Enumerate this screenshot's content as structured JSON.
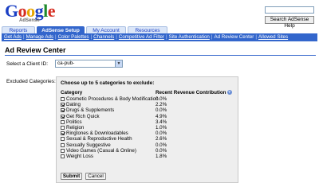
{
  "logo": {
    "letters": [
      "G",
      "o",
      "o",
      "g",
      "l",
      "e"
    ],
    "subtitle": "AdSense"
  },
  "search": {
    "button_label": "Search AdSense Help"
  },
  "tabs": [
    {
      "label": "Reports",
      "active": false
    },
    {
      "label": "AdSense Setup",
      "active": true
    },
    {
      "label": "My Account",
      "active": false
    },
    {
      "label": "Resources",
      "active": false
    }
  ],
  "subnav": [
    {
      "label": "Get Ads",
      "current": false
    },
    {
      "label": "Manage Ads",
      "current": false
    },
    {
      "label": "Color Palettes",
      "current": false
    },
    {
      "label": "Channels",
      "current": false
    },
    {
      "label": "Competitive Ad Filter",
      "current": false
    },
    {
      "label": "Site Authentication",
      "current": false
    },
    {
      "label": "Ad Review Center",
      "current": true
    },
    {
      "label": "Allowed Sites",
      "current": false
    }
  ],
  "page": {
    "title": "Ad Review Center",
    "client_label": "Select a Client ID:",
    "client_value": "ca-pub-",
    "excluded_label": "Excluded Categories:"
  },
  "panel": {
    "heading": "Choose up to 5 categories to exclude:",
    "col_category": "Category",
    "col_revenue": "Recent Revenue Contribution",
    "categories": [
      {
        "name": "Cosmetic Procedures & Body Modification",
        "value": "0.0%",
        "checked": false
      },
      {
        "name": "Dating",
        "value": "2.2%",
        "checked": true
      },
      {
        "name": "Drugs & Supplements",
        "value": "0.0%",
        "checked": true
      },
      {
        "name": "Get Rich Quick",
        "value": "4.9%",
        "checked": true
      },
      {
        "name": "Politics",
        "value": "3.4%",
        "checked": false
      },
      {
        "name": "Religion",
        "value": "1.0%",
        "checked": false
      },
      {
        "name": "Ringtones & Downloadables",
        "value": "0.0%",
        "checked": true
      },
      {
        "name": "Sexual & Reproductive Health",
        "value": "2.6%",
        "checked": false
      },
      {
        "name": "Sexually Suggestive",
        "value": "0.0%",
        "checked": false
      },
      {
        "name": "Video Games (Casual & Online)",
        "value": "0.0%",
        "checked": false
      },
      {
        "name": "Weight Loss",
        "value": "1.8%",
        "checked": false
      }
    ],
    "submit_label": "Submit",
    "cancel_label": "Cancel"
  },
  "colors": {
    "accent": "#3366cc",
    "panel_bg": "#eeeeee"
  }
}
